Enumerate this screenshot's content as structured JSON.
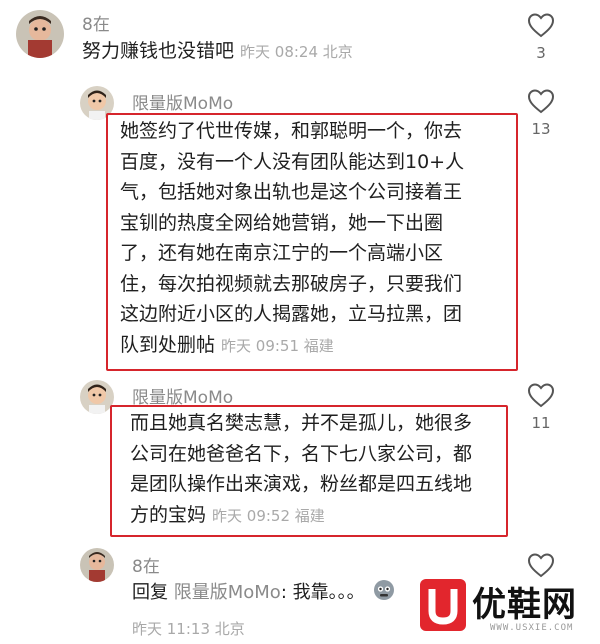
{
  "comments": [
    {
      "username": "8在",
      "text": "努力赚钱也没错吧",
      "time": "昨天 08:24 北京",
      "likes": "3"
    },
    {
      "username": "限量版MoMo",
      "lines": [
        "她签约了代世传媒，和郭聪明一个，你去",
        "百度，没有一个人没有团队能达到10+人",
        "气，包括她对象出轨也是这个公司接着王",
        "宝钏的热度全网给她营销，她一下出圈",
        "了，还有她在南京江宁的一个高端小区",
        "住，每次拍视频就去那破房子，只要我们",
        "这边附近小区的人揭露她，立马拉黑，团",
        "队到处删帖"
      ],
      "time": "昨天 09:51 福建",
      "likes": "13"
    },
    {
      "username": "限量版MoMo",
      "lines": [
        "而且她真名樊志慧，并不是孤儿，她很多",
        "公司在她爸爸名下，名下七八家公司，都",
        "是团队操作出来演戏，粉丝都是四五线地",
        "方的宝妈"
      ],
      "time": "昨天 09:52 福建",
      "likes": "11"
    },
    {
      "username": "8在",
      "reply_prefix": "回复",
      "reply_target": "限量版MoMo",
      "reply_text": ": 我靠。。。",
      "time": "昨天 11:13 北京"
    }
  ],
  "watermark": {
    "brand": "优鞋网",
    "url": "WWW.USXIE.COM"
  },
  "colors": {
    "highlight": "#d6252c",
    "meta_gray": "#a9a9a9"
  },
  "icons": [
    "heart-icon",
    "avatar",
    "emoji-sweat-icon"
  ]
}
